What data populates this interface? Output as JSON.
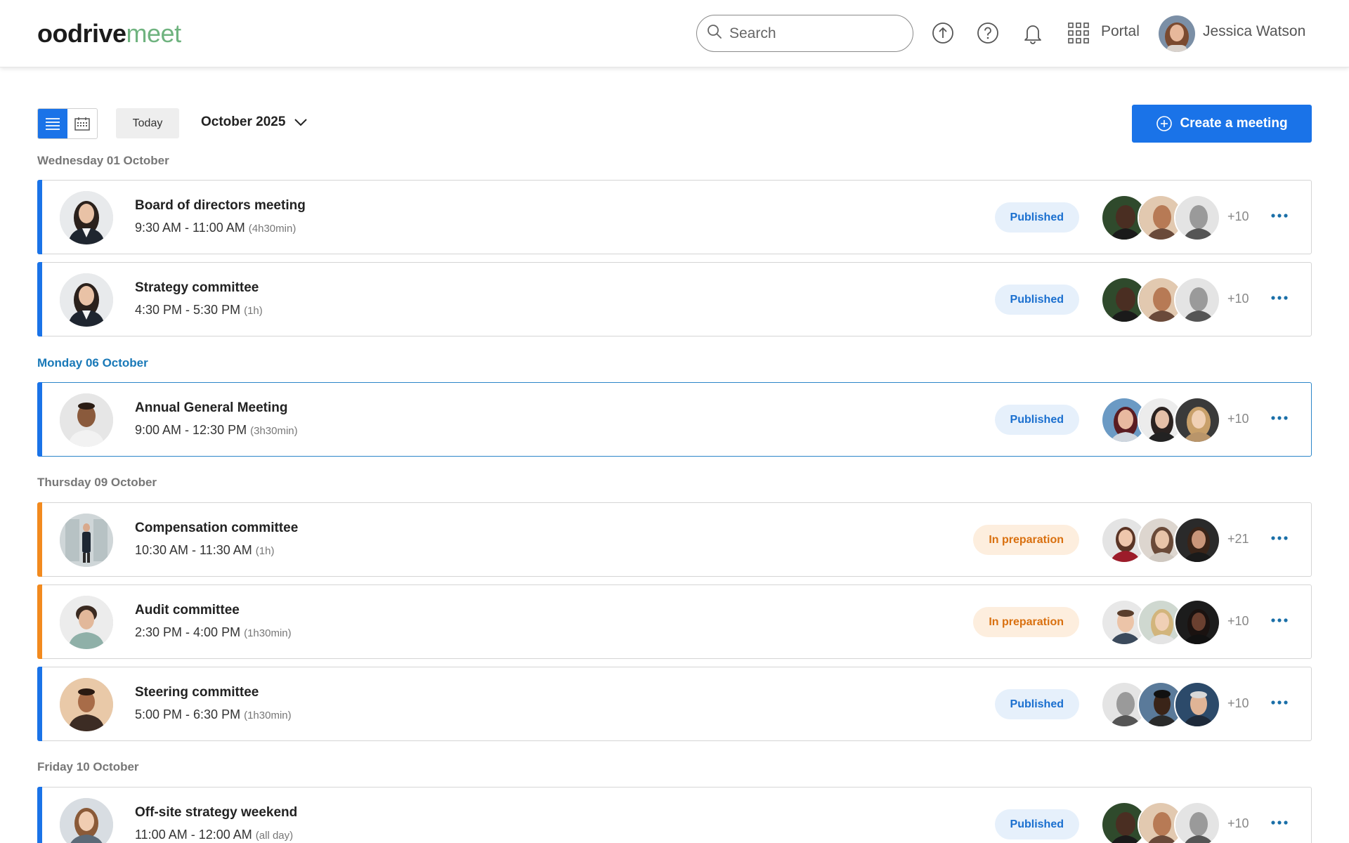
{
  "header": {
    "logo_primary": "oodrive",
    "logo_secondary": "meet",
    "search_placeholder": "Search",
    "portal_label": "Portal",
    "user_name": "Jessica Watson"
  },
  "toolbar": {
    "today_label": "Today",
    "month_label": "October 2025",
    "create_label": "Create a meeting"
  },
  "colors": {
    "accent": "#1a73e8",
    "published_bg": "#e6f0fb",
    "prep_bg": "#fdeede",
    "prep_text": "#d9700f",
    "logo_green": "#6fb37f"
  },
  "days": [
    {
      "label": "Wednesday 01 October",
      "is_today": false,
      "meetings": [
        {
          "title": "Board of directors meeting",
          "time": "9:30 AM - 11:00 AM",
          "duration": "(4h30min)",
          "status": "Published",
          "status_type": "published",
          "extra": "+10",
          "bar": "blue"
        },
        {
          "title": "Strategy committee",
          "time": "4:30 PM - 5:30 PM",
          "duration": "(1h)",
          "status": "Published",
          "status_type": "published",
          "extra": "+10",
          "bar": "blue"
        }
      ]
    },
    {
      "label": "Monday 06 October",
      "is_today": true,
      "meetings": [
        {
          "title": "Annual General Meeting",
          "time": "9:00 AM - 12:30 PM",
          "duration": "(3h30min)",
          "status": "Published",
          "status_type": "published",
          "extra": "+10",
          "bar": "blue"
        }
      ]
    },
    {
      "label": "Thursday 09 October",
      "is_today": false,
      "meetings": [
        {
          "title": "Compensation committee",
          "time": "10:30 AM - 11:30 AM",
          "duration": "(1h)",
          "status": "In preparation",
          "status_type": "prep",
          "extra": "+21",
          "bar": "orange"
        },
        {
          "title": "Audit committee",
          "time": "2:30 PM - 4:00 PM",
          "duration": "(1h30min)",
          "status": "In preparation",
          "status_type": "prep",
          "extra": "+10",
          "bar": "orange"
        },
        {
          "title": "Steering committee",
          "time": "5:00 PM - 6:30 PM",
          "duration": "(1h30min)",
          "status": "Published",
          "status_type": "published",
          "extra": "+10",
          "bar": "blue"
        }
      ]
    },
    {
      "label": "Friday 10 October",
      "is_today": false,
      "meetings": [
        {
          "title": "Off-site strategy weekend",
          "time": "11:00 AM - 12:00 AM",
          "duration": "(all day)",
          "status": "Published",
          "status_type": "published",
          "extra": "+10",
          "bar": "blue"
        }
      ]
    }
  ]
}
